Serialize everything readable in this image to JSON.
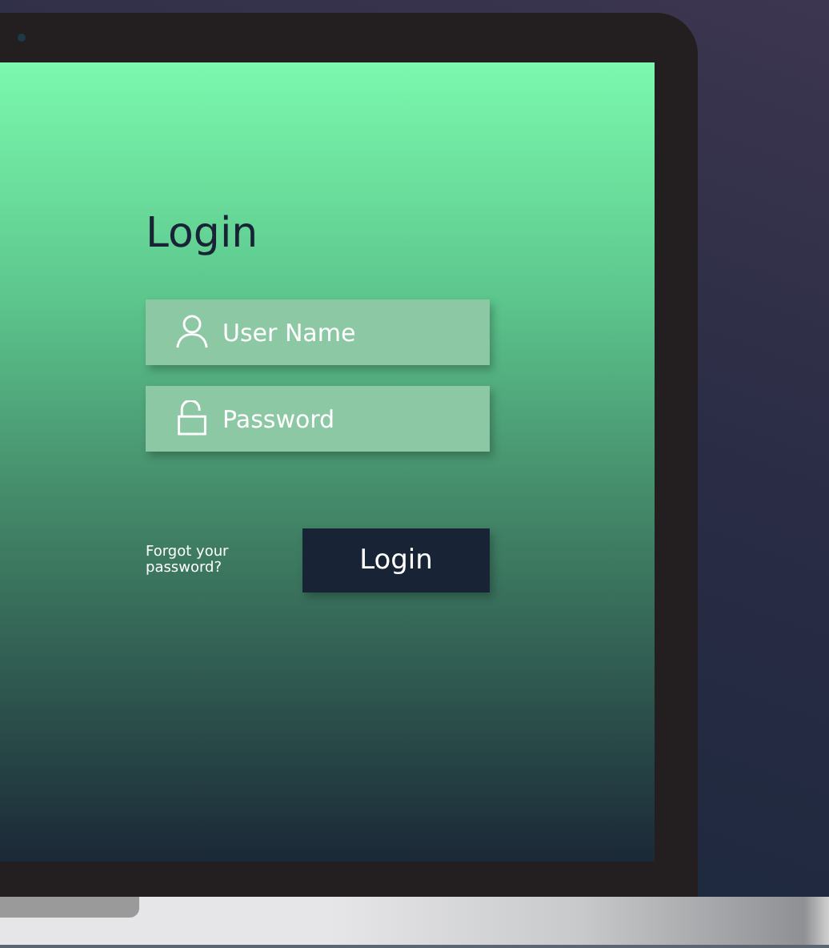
{
  "login_form": {
    "title": "Login",
    "fields": [
      {
        "kind": "text",
        "placeholder": "User Name"
      },
      {
        "kind": "password",
        "placeholder": "Password"
      }
    ],
    "forgot_link": "Forgot your password?",
    "submit_button": "Login"
  }
}
